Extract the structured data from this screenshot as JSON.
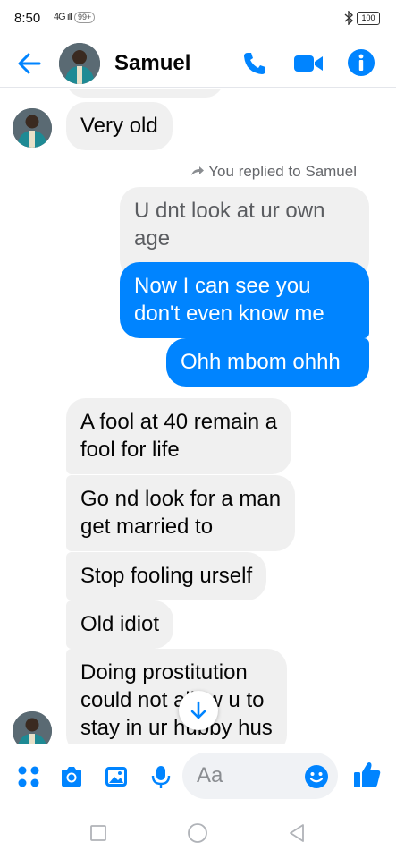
{
  "status_bar": {
    "time": "8:50",
    "signal": "4G ıll",
    "notif_badge": "99+",
    "battery": "100"
  },
  "header": {
    "contact_name": "Samuel"
  },
  "chat": {
    "reply_note": "You replied to Samuel",
    "messages": [
      {
        "from": "contact",
        "text": "Very old"
      },
      {
        "from": "me",
        "type": "reply-preview",
        "lines": [
          "U dnt look at ur own",
          "age"
        ]
      },
      {
        "from": "me",
        "lines": [
          "Now I can see you",
          "don't even know me"
        ]
      },
      {
        "from": "me",
        "text": "Ohh mbom ohhh"
      },
      {
        "from": "contact",
        "lines": [
          "A fool at 40 remain a",
          "fool for life"
        ]
      },
      {
        "from": "contact",
        "lines": [
          "Go nd look for a man",
          "get married to"
        ]
      },
      {
        "from": "contact",
        "text": "Stop fooling urself"
      },
      {
        "from": "contact",
        "text": "Old idiot"
      },
      {
        "from": "contact",
        "lines": [
          "Doing prostitution",
          "could not allow u to",
          "stay in ur hubby hus"
        ]
      }
    ]
  },
  "composer": {
    "placeholder": "Aa"
  },
  "colors": {
    "accent": "#0084ff",
    "incoming_bubble": "#f0f0f0"
  },
  "icons": {
    "back": "arrow-left-icon",
    "call": "phone-icon",
    "video": "video-camera-icon",
    "info": "info-icon",
    "apps": "four-dots-icon",
    "camera": "camera-icon",
    "gallery": "image-icon",
    "mic": "microphone-icon",
    "emoji": "smiley-icon",
    "like": "thumbs-up-icon",
    "scroll": "arrow-down-icon"
  }
}
